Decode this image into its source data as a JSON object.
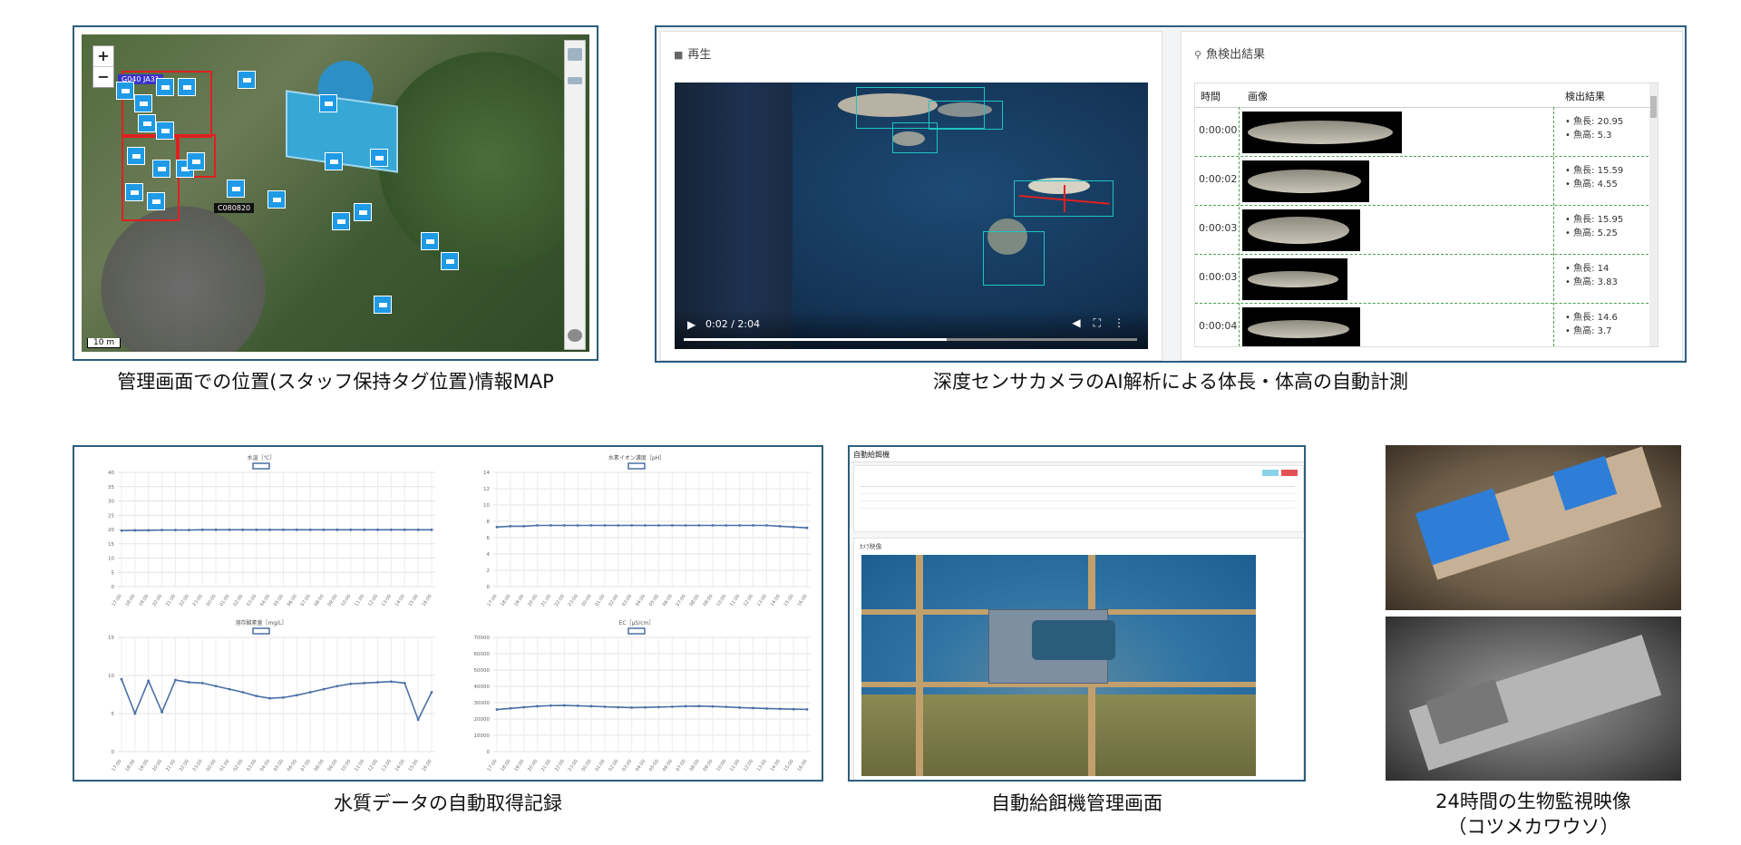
{
  "captions": {
    "map": "管理画面での位置(スタッフ保持タグ位置)情報MAP",
    "fish": "深度センサカメラのAI解析による体長・体高の自動計測",
    "water": "水質データの自動取得記録",
    "feeder": "自動給餌機管理画面",
    "cam_line1": "24時間の生物監視映像",
    "cam_line2": "（コツメカワウソ）"
  },
  "map": {
    "zoom_in": "+",
    "zoom_out": "−",
    "label": "C080820",
    "scale": "10 m",
    "colors": {
      "sensor": "#1e9ae6",
      "zone": "#e02020"
    }
  },
  "fish": {
    "video_title": "再生",
    "detect_title": "魚検出結果",
    "video_time": "0:02 / 2:04",
    "progress": 0.58,
    "headers": {
      "time": "時間",
      "image": "画像",
      "result": "検出結果"
    },
    "rows": [
      {
        "time": "0:00:00",
        "len": "魚長: 20.95",
        "height": "魚高: 5.3"
      },
      {
        "time": "0:00:02",
        "len": "魚長: 15.59",
        "height": "魚高: 4.55"
      },
      {
        "time": "0:00:03",
        "len": "魚長: 15.95",
        "height": "魚高: 5.25"
      },
      {
        "time": "0:00:03",
        "len": "魚長: 14",
        "height": "魚高: 3.83"
      },
      {
        "time": "0:00:04",
        "len": "魚長: 14.6",
        "height": "魚高: 3.7"
      }
    ]
  },
  "chart_data": [
    {
      "type": "line",
      "title": "水温［℃］",
      "ylim": [
        0,
        40
      ],
      "yticks": [
        "0",
        "5",
        "10",
        "15",
        "20",
        "25",
        "30",
        "35",
        "40"
      ],
      "x": [
        "17:00",
        "18:00",
        "19:00",
        "20:00",
        "21:00",
        "22:00",
        "23:00",
        "00:00",
        "01:00",
        "02:00",
        "03:00",
        "04:00",
        "05:00",
        "06:00",
        "07:00",
        "08:00",
        "09:00",
        "10:00",
        "11:00",
        "12:00",
        "13:00",
        "14:00",
        "15:00",
        "16:00"
      ],
      "values": [
        19.6,
        19.7,
        19.7,
        19.8,
        19.8,
        19.8,
        19.9,
        19.9,
        19.9,
        19.9,
        19.9,
        19.9,
        19.9,
        19.9,
        19.9,
        19.9,
        19.9,
        19.9,
        19.9,
        19.9,
        19.9,
        19.9,
        19.9,
        19.9
      ]
    },
    {
      "type": "line",
      "title": "水素イオン濃度［pH］",
      "ylim": [
        0,
        14
      ],
      "yticks": [
        "0",
        "2",
        "4",
        "6",
        "8",
        "10",
        "12",
        "14"
      ],
      "x": [
        "17:00",
        "18:00",
        "19:00",
        "20:00",
        "21:00",
        "22:00",
        "23:00",
        "00:00",
        "01:00",
        "02:00",
        "03:00",
        "04:00",
        "05:00",
        "06:00",
        "07:00",
        "08:00",
        "09:00",
        "10:00",
        "11:00",
        "12:00",
        "13:00",
        "14:00",
        "15:00",
        "16:00"
      ],
      "values": [
        7.3,
        7.4,
        7.4,
        7.5,
        7.5,
        7.5,
        7.5,
        7.5,
        7.5,
        7.5,
        7.5,
        7.5,
        7.5,
        7.5,
        7.5,
        7.5,
        7.5,
        7.5,
        7.5,
        7.5,
        7.5,
        7.4,
        7.3,
        7.2
      ]
    },
    {
      "type": "line",
      "title": "溶存酸素量［mg/L］",
      "ylim": [
        0,
        15
      ],
      "yticks": [
        "0",
        "5",
        "10",
        "15"
      ],
      "x": [
        "17:00",
        "18:00",
        "19:00",
        "20:00",
        "21:00",
        "22:00",
        "23:00",
        "00:00",
        "01:00",
        "02:00",
        "03:00",
        "04:00",
        "05:00",
        "06:00",
        "07:00",
        "08:00",
        "09:00",
        "10:00",
        "11:00",
        "12:00",
        "13:00",
        "14:00",
        "15:00",
        "16:00"
      ],
      "values": [
        9.5,
        5.0,
        9.3,
        5.2,
        9.4,
        9.1,
        9.0,
        8.6,
        8.2,
        7.8,
        7.3,
        7.0,
        7.1,
        7.4,
        7.8,
        8.2,
        8.6,
        8.9,
        9.0,
        9.1,
        9.2,
        9.0,
        4.2,
        7.8
      ]
    },
    {
      "type": "line",
      "title": "EC［μS/cm］",
      "ylim": [
        0,
        70000
      ],
      "yticks": [
        "0",
        "10000",
        "20000",
        "30000",
        "40000",
        "50000",
        "60000",
        "70000"
      ],
      "x": [
        "17:00",
        "18:00",
        "19:00",
        "20:00",
        "21:00",
        "22:00",
        "23:00",
        "00:00",
        "01:00",
        "02:00",
        "03:00",
        "04:00",
        "05:00",
        "06:00",
        "07:00",
        "08:00",
        "09:00",
        "10:00",
        "11:00",
        "12:00",
        "13:00",
        "14:00",
        "15:00",
        "16:00"
      ],
      "values": [
        25800,
        26500,
        27200,
        27800,
        28200,
        28300,
        28100,
        27800,
        27500,
        27200,
        27000,
        27100,
        27300,
        27500,
        27800,
        27900,
        27700,
        27400,
        27000,
        26700,
        26400,
        26200,
        26000,
        25900
      ]
    }
  ],
  "feeder": {
    "title": "自動給餌機",
    "cam_section": "ｶﾒﾗ映像"
  }
}
